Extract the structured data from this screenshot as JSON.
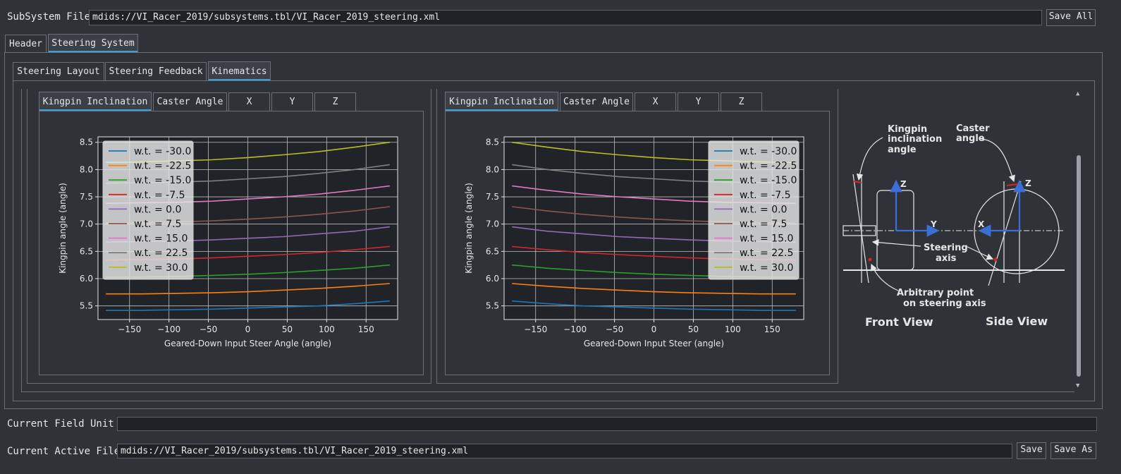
{
  "top": {
    "subsystem_label": "SubSystem File",
    "subsystem_value": "mdids://VI_Racer_2019/subsystems.tbl/VI_Racer_2019_steering.xml",
    "save_all": "Save All"
  },
  "main_tabs": [
    "Header",
    "Steering System"
  ],
  "sub_tabs": [
    "Steering Layout",
    "Steering Feedback",
    "Kinematics"
  ],
  "plot_tabs": [
    "Kingpin Inclination",
    "Caster Angle",
    "X",
    "Y",
    "Z"
  ],
  "diagram": {
    "kingpin_label_1": "Kingpin",
    "kingpin_label_2": "inclination",
    "kingpin_label_3": "angle",
    "caster_label_1": "Caster",
    "caster_label_2": "angle",
    "steering_axis_1": "Steering",
    "steering_axis_2": "axis",
    "arb_point_1": "Arbitrary point",
    "arb_point_2": "on steering axis",
    "front_view": "Front View",
    "side_view": "Side View",
    "axis_z": "Z",
    "axis_y": "Y",
    "axis_x": "X"
  },
  "chart_data": [
    {
      "type": "line",
      "xlabel": "Geared-Down Input Steer Angle (angle)",
      "ylabel": "Kingpin angle (angle)",
      "xlim": [
        -190,
        190
      ],
      "ylim": [
        5.25,
        8.6
      ],
      "xticks": [
        -150,
        -100,
        -50,
        0,
        50,
        100,
        150
      ],
      "yticks": [
        5.5,
        6.0,
        6.5,
        7.0,
        7.5,
        8.0,
        8.5
      ],
      "grid": true,
      "legend": "upper-left",
      "x": [
        -180,
        -135,
        -90,
        -45,
        0,
        45,
        90,
        135,
        180
      ],
      "series": [
        {
          "name": "w.t. = -30.0",
          "color": "#1f77b4",
          "values": [
            5.42,
            5.42,
            5.43,
            5.44,
            5.46,
            5.48,
            5.5,
            5.54,
            5.59
          ]
        },
        {
          "name": "w.t. = -22.5",
          "color": "#ff7f0e",
          "values": [
            5.72,
            5.72,
            5.73,
            5.74,
            5.76,
            5.79,
            5.82,
            5.86,
            5.91
          ]
        },
        {
          "name": "w.t. = -15.0",
          "color": "#2ca02c",
          "values": [
            6.03,
            6.03,
            6.04,
            6.06,
            6.08,
            6.11,
            6.15,
            6.19,
            6.25
          ]
        },
        {
          "name": "w.t. = -7.5",
          "color": "#d62728",
          "values": [
            6.34,
            6.35,
            6.36,
            6.38,
            6.41,
            6.44,
            6.48,
            6.53,
            6.59
          ]
        },
        {
          "name": "w.t. = 0.0",
          "color": "#9467bd",
          "values": [
            6.67,
            6.68,
            6.69,
            6.71,
            6.74,
            6.77,
            6.82,
            6.87,
            6.95
          ]
        },
        {
          "name": "w.t. = 7.5",
          "color": "#8c564b",
          "values": [
            7.02,
            7.03,
            7.04,
            7.06,
            7.09,
            7.13,
            7.18,
            7.24,
            7.32
          ]
        },
        {
          "name": "w.t. = 15.0",
          "color": "#e377c2",
          "values": [
            7.38,
            7.39,
            7.4,
            7.42,
            7.46,
            7.5,
            7.55,
            7.62,
            7.7
          ]
        },
        {
          "name": "w.t. = 22.5",
          "color": "#7f7f7f",
          "values": [
            7.75,
            7.76,
            7.77,
            7.79,
            7.83,
            7.87,
            7.93,
            8.0,
            8.09
          ]
        },
        {
          "name": "w.t. = 30.0",
          "color": "#bcbd22",
          "values": [
            8.13,
            8.14,
            8.16,
            8.18,
            8.22,
            8.27,
            8.33,
            8.41,
            8.5
          ]
        }
      ]
    },
    {
      "type": "line",
      "xlabel": "Geared-Down Input Steer (angle)",
      "ylabel": "Kingpin angle (angle)",
      "xlim": [
        -190,
        190
      ],
      "ylim": [
        5.25,
        8.6
      ],
      "xticks": [
        -150,
        -100,
        -50,
        0,
        50,
        100,
        150
      ],
      "yticks": [
        5.5,
        6.0,
        6.5,
        7.0,
        7.5,
        8.0,
        8.5
      ],
      "grid": true,
      "legend": "upper-right",
      "x": [
        -180,
        -135,
        -90,
        -45,
        0,
        45,
        90,
        135,
        180
      ],
      "series": [
        {
          "name": "w.t. = -30.0",
          "color": "#1f77b4",
          "values": [
            5.59,
            5.54,
            5.5,
            5.48,
            5.46,
            5.44,
            5.43,
            5.42,
            5.42
          ]
        },
        {
          "name": "w.t. = -22.5",
          "color": "#ff7f0e",
          "values": [
            5.91,
            5.86,
            5.82,
            5.79,
            5.76,
            5.74,
            5.73,
            5.72,
            5.72
          ]
        },
        {
          "name": "w.t. = -15.0",
          "color": "#2ca02c",
          "values": [
            6.25,
            6.19,
            6.15,
            6.11,
            6.08,
            6.06,
            6.04,
            6.03,
            6.03
          ]
        },
        {
          "name": "w.t. = -7.5",
          "color": "#d62728",
          "values": [
            6.59,
            6.53,
            6.48,
            6.44,
            6.41,
            6.38,
            6.36,
            6.35,
            6.34
          ]
        },
        {
          "name": "w.t. = 0.0",
          "color": "#9467bd",
          "values": [
            6.95,
            6.87,
            6.82,
            6.77,
            6.74,
            6.71,
            6.69,
            6.68,
            6.67
          ]
        },
        {
          "name": "w.t. = 7.5",
          "color": "#8c564b",
          "values": [
            7.32,
            7.24,
            7.18,
            7.13,
            7.09,
            7.06,
            7.04,
            7.03,
            7.02
          ]
        },
        {
          "name": "w.t. = 15.0",
          "color": "#e377c2",
          "values": [
            7.7,
            7.62,
            7.55,
            7.5,
            7.46,
            7.42,
            7.4,
            7.39,
            7.38
          ]
        },
        {
          "name": "w.t. = 22.5",
          "color": "#7f7f7f",
          "values": [
            8.09,
            8.0,
            7.93,
            7.87,
            7.83,
            7.79,
            7.77,
            7.76,
            7.75
          ]
        },
        {
          "name": "w.t. = 30.0",
          "color": "#bcbd22",
          "values": [
            8.5,
            8.41,
            8.33,
            8.27,
            8.22,
            8.18,
            8.16,
            8.14,
            8.13
          ]
        }
      ]
    }
  ],
  "bottom": {
    "unit_label": "Current Field Unit",
    "unit_value": "",
    "active_label": "Current Active File",
    "active_value": "mdids://VI_Racer_2019/subsystems.tbl/VI_Racer_2019_steering.xml",
    "save": "Save",
    "save_as": "Save As"
  }
}
